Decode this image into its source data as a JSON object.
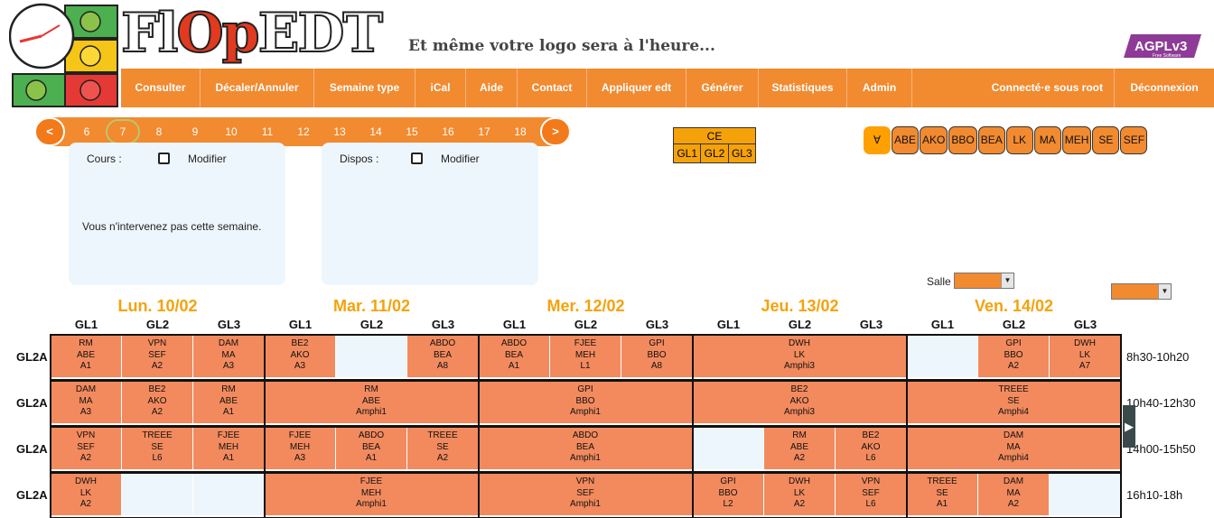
{
  "header": {
    "logo_text": "FlOpEDT",
    "tagline": "Et même votre logo sera à l'heure...",
    "license_badge": "AGPLv3",
    "license_sub": "Free Software"
  },
  "nav": {
    "items": [
      "Consulter",
      "Décaler/Annuler",
      "Semaine type",
      "iCal",
      "Aide",
      "Contact",
      "Appliquer edt",
      "Générer",
      "Statistiques",
      "Admin",
      "Connecté·e sous root",
      "Déconnexion"
    ]
  },
  "weeks": {
    "prev": "<",
    "next": ">",
    "numbers": [
      "6",
      "7",
      "8",
      "9",
      "10",
      "11",
      "12",
      "13",
      "14",
      "15",
      "16",
      "17",
      "18"
    ],
    "selected": "7"
  },
  "panel_cours": {
    "label": "Cours :",
    "modify": "Modifier",
    "message": "Vous n'intervenez pas cette semaine."
  },
  "panel_dispos": {
    "label": "Dispos :",
    "modify": "Modifier"
  },
  "groups_selector": {
    "head": "CE",
    "groups": [
      "GL1",
      "GL2",
      "GL3"
    ]
  },
  "profs": [
    "∀",
    "ABE",
    "AKO",
    "BBO",
    "BEA",
    "LK",
    "MA",
    "MEH",
    "SE",
    "SEF"
  ],
  "salle": {
    "label": "Salle"
  },
  "timetable": {
    "days": [
      "Lun. 10/02",
      "Mar. 11/02",
      "Mer. 12/02",
      "Jeu. 13/02",
      "Ven. 14/02"
    ],
    "groups": [
      "GL1",
      "GL2",
      "GL3"
    ],
    "row_label": "GL2A",
    "times": [
      "8h30-10h20",
      "10h40-12h30",
      "14h00-15h50",
      "16h10-18h"
    ],
    "rows": [
      [
        [
          [
            "RM",
            "ABE",
            "A1"
          ],
          [
            "VPN",
            "SEF",
            "A2"
          ],
          [
            "DAM",
            "MA",
            "A3"
          ]
        ],
        [
          [
            "BE2",
            "AKO",
            "A3"
          ],
          null,
          [
            "ABDO",
            "BEA",
            "A8"
          ]
        ],
        [
          [
            "ABDO",
            "BEA",
            "A1"
          ],
          [
            "FJEE",
            "MEH",
            "L1"
          ],
          [
            "GPI",
            "BBO",
            "A8"
          ]
        ],
        [
          {
            "span": 3,
            "t": [
              "DWH",
              "LK",
              "Amphi3"
            ]
          }
        ],
        [
          null,
          [
            "GPI",
            "BBO",
            "A2"
          ],
          [
            "DWH",
            "LK",
            "A7"
          ]
        ]
      ],
      [
        [
          [
            "DAM",
            "MA",
            "A3"
          ],
          [
            "BE2",
            "AKO",
            "A2"
          ],
          [
            "RM",
            "ABE",
            "A1"
          ]
        ],
        [
          {
            "span": 3,
            "t": [
              "RM",
              "ABE",
              "Amphi1"
            ]
          }
        ],
        [
          {
            "span": 3,
            "t": [
              "GPI",
              "BBO",
              "Amphi1"
            ]
          }
        ],
        [
          {
            "span": 3,
            "t": [
              "BE2",
              "AKO",
              "Amphi3"
            ]
          }
        ],
        [
          {
            "span": 3,
            "t": [
              "TREEE",
              "SE",
              "Amphi4"
            ]
          }
        ]
      ],
      [
        [
          [
            "VPN",
            "SEF",
            "A2"
          ],
          [
            "TREEE",
            "SE",
            "L6"
          ],
          [
            "FJEE",
            "MEH",
            "A1"
          ]
        ],
        [
          [
            "FJEE",
            "MEH",
            "A3"
          ],
          [
            "ABDO",
            "BEA",
            "A1"
          ],
          [
            "TREEE",
            "SE",
            "A2"
          ]
        ],
        [
          {
            "span": 3,
            "t": [
              "ABDO",
              "BEA",
              "Amphi1"
            ]
          }
        ],
        [
          null,
          [
            "RM",
            "ABE",
            "A2"
          ],
          [
            "BE2",
            "AKO",
            "L6"
          ]
        ],
        [
          {
            "span": 3,
            "t": [
              "DAM",
              "MA",
              "Amphi4"
            ]
          }
        ]
      ],
      [
        [
          [
            "DWH",
            "LK",
            "A2"
          ],
          null,
          null
        ],
        [
          {
            "span": 3,
            "t": [
              "FJEE",
              "MEH",
              "Amphi1"
            ]
          }
        ],
        [
          {
            "span": 3,
            "t": [
              "VPN",
              "SEF",
              "Amphi1"
            ]
          }
        ],
        [
          [
            "GPI",
            "BBO",
            "L2"
          ],
          [
            "DWH",
            "LK",
            "A2"
          ],
          [
            "VPN",
            "SEF",
            "L6"
          ]
        ],
        [
          [
            "TREEE",
            "SE",
            "A1"
          ],
          [
            "DAM",
            "MA",
            "A2"
          ],
          null
        ]
      ]
    ]
  },
  "colors": {
    "nav": "#f28a30",
    "slot": "#f28a5e",
    "empty_slot": "#eef6fd",
    "day_title": "#f5a20a"
  }
}
